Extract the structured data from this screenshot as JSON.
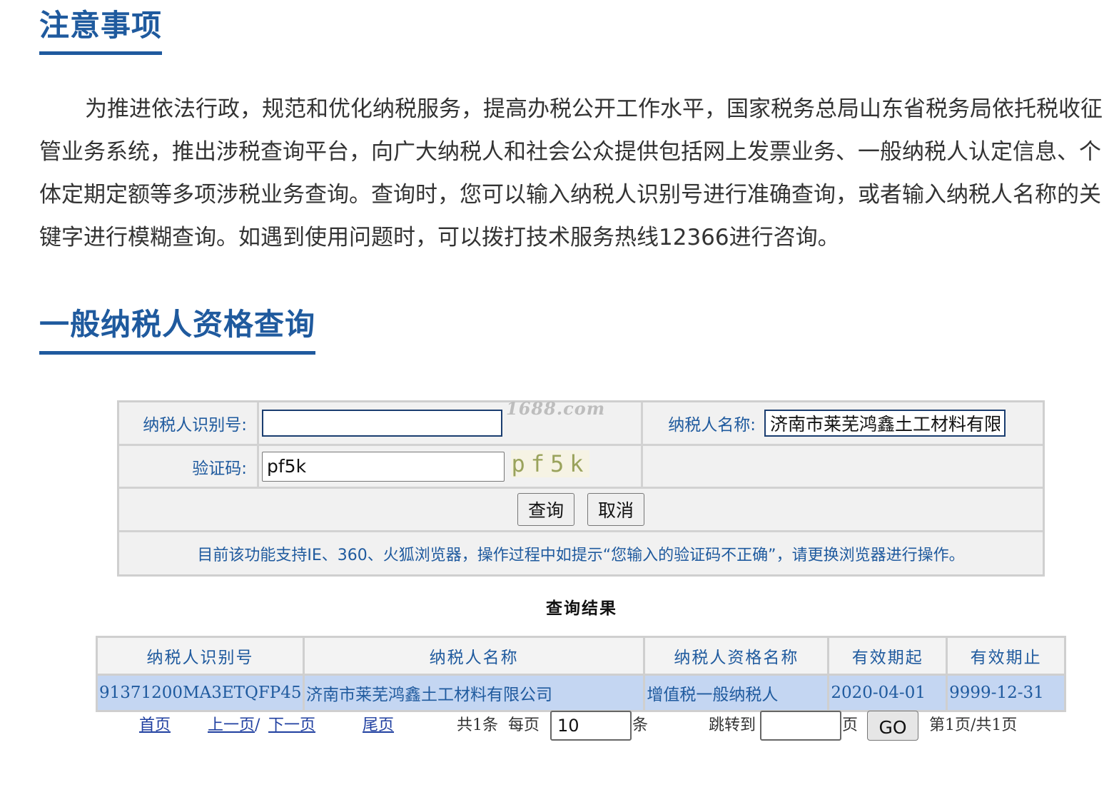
{
  "notice": {
    "title": "注意事项",
    "text": "为推进依法行政，规范和优化纳税服务，提高办税公开工作水平，国家税务总局山东省税务局依托税收征管业务系统，推出涉税查询平台，向广大纳税人和社会公众提供包括网上发票业务、一般纳税人认定信息、个体定期定额等多项涉税业务查询。查询时，您可以输入纳税人识别号进行准确查询，或者输入纳税人名称的关键字进行模糊查询。如遇到使用问题时，可以拨打技术服务热线12366进行咨询。"
  },
  "query": {
    "title": "一般纳税人资格查询",
    "taxid_label": "纳税人识别号:",
    "taxid_value": "",
    "name_label": "纳税人名称:",
    "name_value": "济南市莱芜鸿鑫土工材料有限公司",
    "captcha_label": "验证码:",
    "captcha_value": "pf5k",
    "captcha_image_text": "pf5k",
    "watermark": "1688.com",
    "search_button": "查询",
    "cancel_button": "取消",
    "browser_notice": "目前该功能支持IE、360、火狐浏览器，操作过程中如提示“您输入的验证码不正确”，请更换浏览器进行操作。"
  },
  "results": {
    "title": "查询结果",
    "columns": [
      "纳税人识别号",
      "纳税人名称",
      "纳税人资格名称",
      "有效期起",
      "有效期止"
    ],
    "rows": [
      [
        "91371200MA3ETQFP45",
        "济南市莱芜鸿鑫土工材料有限公司",
        "增值税一般纳税人",
        "2020-04-01",
        "9999-12-31"
      ]
    ]
  },
  "pager": {
    "first": "首页",
    "prev": "上一页",
    "separator": "/",
    "next": "下一页",
    "last": "尾页",
    "total": "共1条",
    "per_page_label": "每页",
    "per_page_value": "10",
    "per_page_unit": "条",
    "jump_label": "跳转到",
    "jump_value": "",
    "page_unit": "页",
    "go_button": "GO",
    "page_info": "第1页/共1页"
  },
  "colors": {
    "heading": "#1f5a9e",
    "row_highlight": "#c4d6f2",
    "link": "#1f3fa0"
  }
}
